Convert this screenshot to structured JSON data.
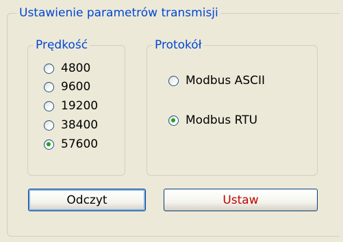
{
  "transmission_group": {
    "title": "Ustawienie parametrów transmisji"
  },
  "speed_group": {
    "title": "Prędkość",
    "options": [
      {
        "label": "4800",
        "selected": false
      },
      {
        "label": "9600",
        "selected": false
      },
      {
        "label": "19200",
        "selected": false
      },
      {
        "label": "38400",
        "selected": false
      },
      {
        "label": "57600",
        "selected": true
      }
    ]
  },
  "protocol_group": {
    "title": "Protokół",
    "options": [
      {
        "label": "Modbus ASCII",
        "selected": false
      },
      {
        "label": "Modbus RTU",
        "selected": true
      }
    ]
  },
  "buttons": {
    "read_label": "Odczyt",
    "set_label": "Ustaw"
  },
  "colors": {
    "legend_text": "#0046D5",
    "radio_dot": "#21A121",
    "set_button_text": "#C00000",
    "window_bg": "#ECE9D8"
  }
}
